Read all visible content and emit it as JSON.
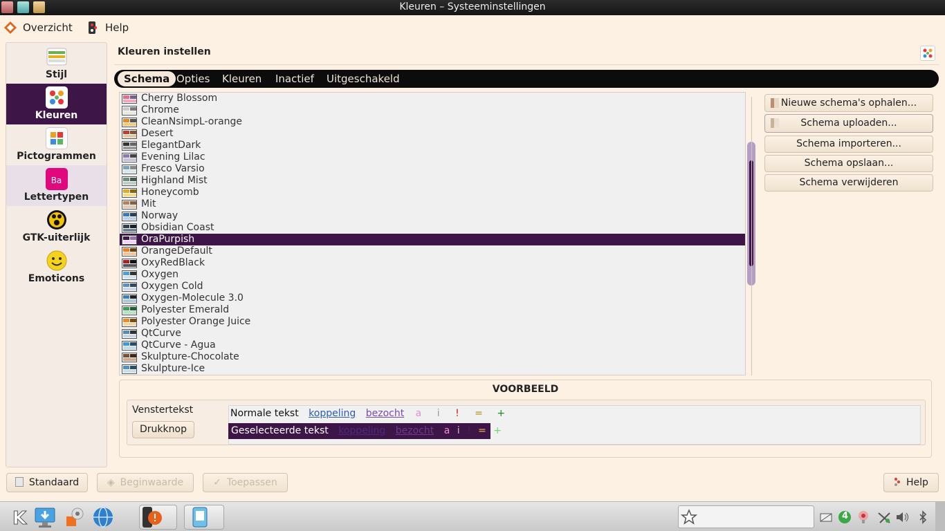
{
  "window": {
    "title": "Kleuren – Systeeminstellingen"
  },
  "menubar": {
    "overview": "Overzicht",
    "help": "Help"
  },
  "sidebar": {
    "items": [
      {
        "label": "Stijl",
        "icon": "style-icon"
      },
      {
        "label": "Kleuren",
        "icon": "colors-icon"
      },
      {
        "label": "Pictogrammen",
        "icon": "icons-icon"
      },
      {
        "label": "Lettertypen",
        "icon": "fonts-icon"
      },
      {
        "label": "GTK-uiterlijk",
        "icon": "gtk-icon"
      },
      {
        "label": "Emoticons",
        "icon": "emoticon-icon"
      }
    ],
    "fonts_icon_text": "Ba"
  },
  "content": {
    "title": "Kleuren instellen"
  },
  "tabs": [
    "Schema",
    "Opties",
    "Kleuren",
    "Inactief",
    "Uitgeschakeld"
  ],
  "schemes": [
    "Cherry Blossom",
    "Chrome",
    "CleanNsimpL-orange",
    "Desert",
    "ElegantDark",
    "Evening Lilac",
    "Fresco Varsio",
    "Highland Mist",
    "Honeycomb",
    "Mit",
    "Norway",
    "Obsidian Coast",
    "OraPurpish",
    "OrangeDefault",
    "OxyRedBlack",
    "Oxygen",
    "Oxygen Cold",
    "Oxygen-Molecule 3.0",
    "Polyester Emerald",
    "Polyester Orange Juice",
    "QtCurve",
    "QtCurve - Agua",
    "Skulpture-Chocolate",
    "Skulpture-Ice"
  ],
  "selected_scheme": "OraPurpish",
  "actions": {
    "get_new": "Nieuwe schema's ophalen...",
    "upload": "Schema uploaden...",
    "import": "Schema importeren...",
    "save": "Schema opslaan...",
    "delete": "Schema verwijderen"
  },
  "preview": {
    "title": "VOORBEELD",
    "window_text": "Venstertekst",
    "push_button": "Drukknop",
    "normal_text": "Normale tekst",
    "link": "koppeling",
    "visited": "bezocht",
    "a": "a",
    "i": "i",
    "bang": "!",
    "eq": "=",
    "plus": "+",
    "selected_text": "Geselecteerde tekst"
  },
  "bottom": {
    "defaults": "Standaard",
    "reset": "Beginwaarde",
    "apply": "Toepassen",
    "help": "Help"
  },
  "taskbar": {
    "tray_badge": "4"
  },
  "colors": {
    "accent": "#3d1647",
    "background": "#fdf1e4",
    "link": "#2c5db0",
    "visited": "#7b4ab0"
  }
}
